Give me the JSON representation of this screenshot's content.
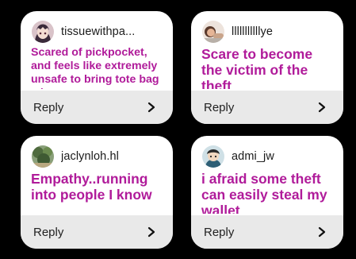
{
  "colors": {
    "background": "#000000",
    "card": "#ffffff",
    "message_text": "#b01b9a",
    "reply_bar": "#e9e9e9"
  },
  "cards": [
    {
      "username": "tissuewithpa...",
      "message": "Scared of pickpocket, and feels like extremely unsafe to bring tote bag w/o",
      "reply_label": "Reply",
      "chevron_icon": "chevron-right-icon"
    },
    {
      "username": "lllllllllllye",
      "message": "Scare to become the victim of the theft",
      "reply_label": "Reply",
      "chevron_icon": "chevron-right-icon"
    },
    {
      "username": "jaclynloh.hl",
      "message": "Empathy..running into people I know",
      "reply_label": "Reply",
      "chevron_icon": "chevron-right-icon"
    },
    {
      "username": "admi_jw",
      "message": "i afraid some theft can easily steal my wallet",
      "reply_label": "Reply",
      "chevron_icon": "chevron-right-icon"
    }
  ]
}
